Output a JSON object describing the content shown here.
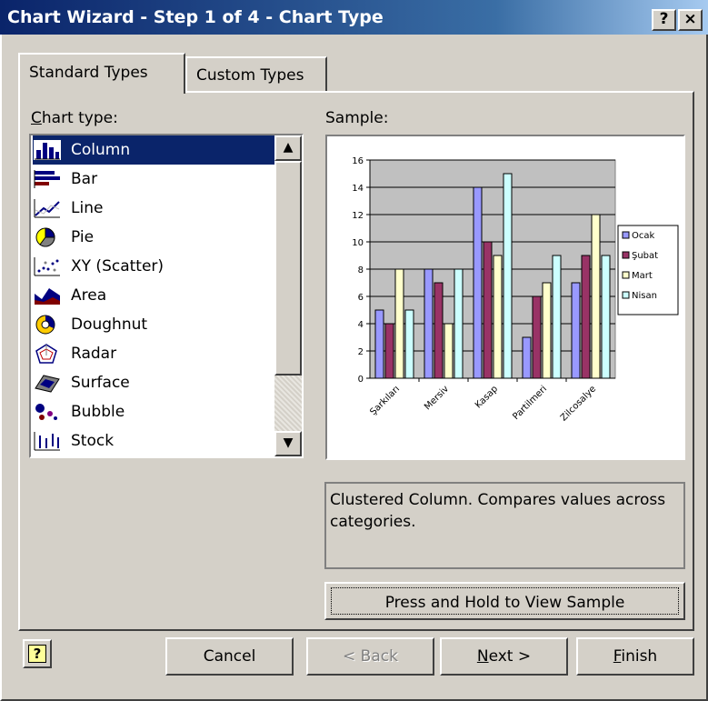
{
  "window": {
    "title": "Chart Wizard - Step 1 of 4 - Chart Type",
    "help_glyph": "?",
    "close_glyph": "×"
  },
  "tabs": [
    {
      "label": "Standard Types",
      "active": true
    },
    {
      "label": "Custom Types",
      "active": false
    }
  ],
  "chart_type_label": {
    "underlined": "C",
    "rest": "hart type:"
  },
  "sample_label": "Sample:",
  "chart_types": [
    {
      "label": "Column",
      "icon": "column-chart-icon",
      "selected": true
    },
    {
      "label": "Bar",
      "icon": "bar-chart-icon",
      "selected": false
    },
    {
      "label": "Line",
      "icon": "line-chart-icon",
      "selected": false
    },
    {
      "label": "Pie",
      "icon": "pie-chart-icon",
      "selected": false
    },
    {
      "label": "XY (Scatter)",
      "icon": "scatter-chart-icon",
      "selected": false
    },
    {
      "label": "Area",
      "icon": "area-chart-icon",
      "selected": false
    },
    {
      "label": "Doughnut",
      "icon": "doughnut-chart-icon",
      "selected": false
    },
    {
      "label": "Radar",
      "icon": "radar-chart-icon",
      "selected": false
    },
    {
      "label": "Surface",
      "icon": "surface-chart-icon",
      "selected": false
    },
    {
      "label": "Bubble",
      "icon": "bubble-chart-icon",
      "selected": false
    },
    {
      "label": "Stock",
      "icon": "stock-chart-icon",
      "selected": false
    }
  ],
  "description": "Clustered Column. Compares values across categories.",
  "buttons": {
    "press_hold": "Press and Hold to View Sample",
    "cancel": "Cancel",
    "back": "< Back",
    "next_underlined": "N",
    "next_rest": "ext >",
    "finish_underlined": "F",
    "finish_rest": "inish"
  },
  "chart_data": {
    "type": "bar",
    "categories": [
      "Şarkıları",
      "Mersiv",
      "Kasap",
      "Partilmeri",
      "Zilcosalye"
    ],
    "series": [
      {
        "name": "Ocak",
        "color": "#9999ff",
        "values": [
          5,
          8,
          14,
          3,
          7
        ]
      },
      {
        "name": "Şubat",
        "color": "#993366",
        "values": [
          4,
          7,
          10,
          6,
          9
        ]
      },
      {
        "name": "Mart",
        "color": "#ffffcc",
        "values": [
          8,
          4,
          9,
          7,
          12
        ]
      },
      {
        "name": "Nisan",
        "color": "#ccffff",
        "values": [
          5,
          8,
          15,
          9,
          9
        ]
      }
    ],
    "ylim": [
      0,
      16
    ],
    "yticks": [
      0,
      2,
      4,
      6,
      8,
      10,
      12,
      14,
      16
    ],
    "grid": true,
    "plot_background": "#c0c0c0",
    "legend_position": "right"
  }
}
